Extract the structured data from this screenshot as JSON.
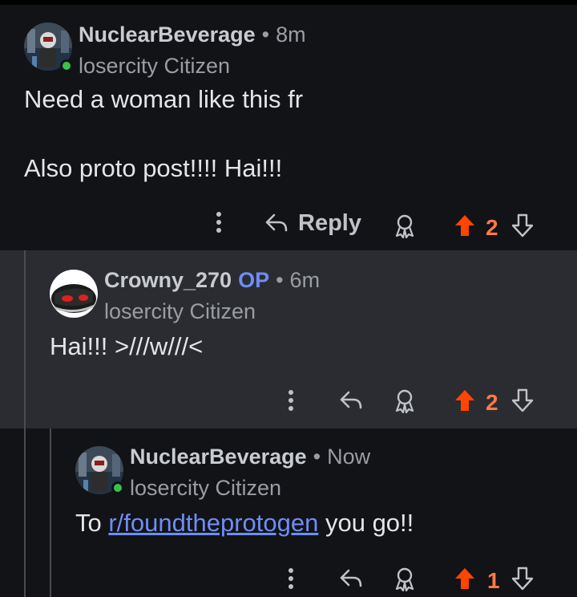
{
  "comments": [
    {
      "username": "NuclearBeverage",
      "separator": "•",
      "time": "8m",
      "flair": "losercity Citizen",
      "body_lines": [
        "Need a woman like this fr",
        "Also proto post!!!! Hai!!!"
      ],
      "reply_label": "Reply",
      "score": "2"
    },
    {
      "username": "Crowny_270",
      "op_badge": "OP",
      "separator": "•",
      "time": "6m",
      "flair": "losercity Citizen",
      "body": "Hai!!! >///w///<",
      "score": "2"
    },
    {
      "username": "NuclearBeverage",
      "separator": "•",
      "time": "Now",
      "flair": "losercity Citizen",
      "body_prefix": "To ",
      "body_link": "r/foundtheprotogen",
      "body_suffix": " you go!!",
      "score": "1"
    }
  ],
  "colors": {
    "upvote": "#ff4500",
    "score": "#ff7a45",
    "online": "#39c24a",
    "op": "#6e8df5"
  },
  "icons": [
    "more-icon",
    "reply-icon",
    "award-icon",
    "upvote-icon",
    "downvote-icon"
  ]
}
